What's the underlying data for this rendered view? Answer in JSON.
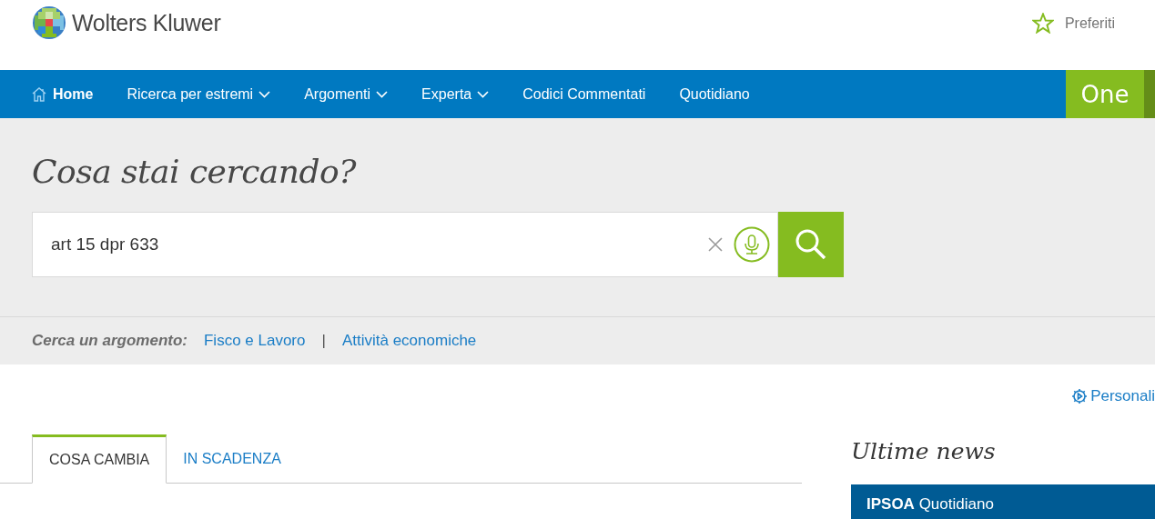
{
  "brand": {
    "name": "Wolters Kluwer"
  },
  "favorites": {
    "label": "Preferiti"
  },
  "nav": {
    "items": [
      {
        "label": "Home",
        "selected": true,
        "dropdown": false,
        "kind": "home"
      },
      {
        "label": "Ricerca per estremi",
        "selected": false,
        "dropdown": true,
        "kind": "link"
      },
      {
        "label": "Argomenti",
        "selected": false,
        "dropdown": true,
        "kind": "link"
      },
      {
        "label": "Experta",
        "selected": false,
        "dropdown": true,
        "kind": "link"
      },
      {
        "label": "Codici Commentati",
        "selected": false,
        "dropdown": false,
        "kind": "link"
      },
      {
        "label": "Quotidiano",
        "selected": false,
        "dropdown": false,
        "kind": "link"
      }
    ],
    "product": "One"
  },
  "search": {
    "heading": "Cosa stai cercando?",
    "value": "art 15 dpr 633"
  },
  "topics": {
    "label": "Cerca un argomento:",
    "links": [
      "Fisco e Lavoro",
      "Attività economiche"
    ],
    "separator": "|"
  },
  "customize": {
    "label": "Personali"
  },
  "tabs": [
    {
      "label": "COSA CAMBIA",
      "selected": true
    },
    {
      "label": "IN SCADENZA",
      "selected": false
    }
  ],
  "news": {
    "heading": "Ultime news",
    "source": "**IPSOA** Quotidiano"
  }
}
